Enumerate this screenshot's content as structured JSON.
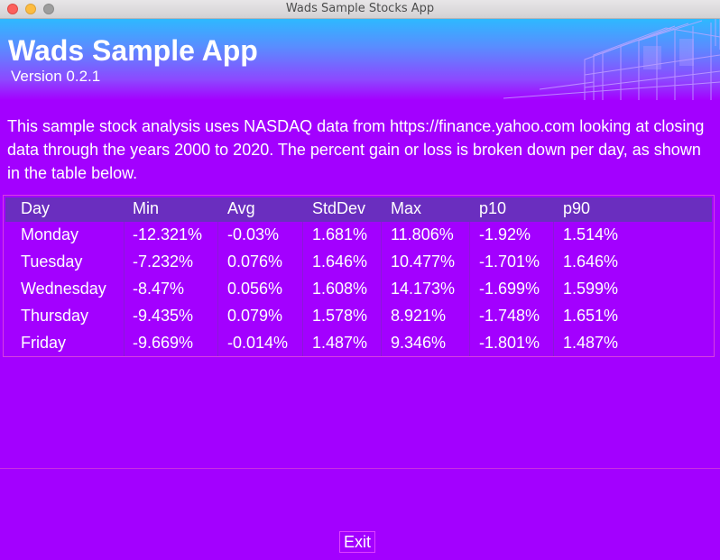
{
  "window": {
    "title": "Wads Sample Stocks App"
  },
  "header": {
    "title": "Wads Sample App",
    "version": "Version 0.2.1"
  },
  "description": "This sample stock analysis uses NASDAQ data from https://finance.yahoo.com looking at closing data through the years 2000 to 2020. The percent gain or loss is broken down per day, as shown in the table below.",
  "table": {
    "columns": [
      "Day",
      "Min",
      "Avg",
      "StdDev",
      "Max",
      "p10",
      "p90"
    ],
    "rows": [
      [
        "Monday",
        "-12.321%",
        "-0.03%",
        "1.681%",
        "11.806%",
        "-1.92%",
        "1.514%"
      ],
      [
        "Tuesday",
        "-7.232%",
        "0.076%",
        "1.646%",
        "10.477%",
        "-1.701%",
        "1.646%"
      ],
      [
        "Wednesday",
        "-8.47%",
        "0.056%",
        "1.608%",
        "14.173%",
        "-1.699%",
        "1.599%"
      ],
      [
        "Thursday",
        "-9.435%",
        "0.079%",
        "1.578%",
        "8.921%",
        "-1.748%",
        "1.651%"
      ],
      [
        "Friday",
        "-9.669%",
        "-0.014%",
        "1.487%",
        "9.346%",
        "-1.801%",
        "1.487%"
      ]
    ]
  },
  "footer": {
    "exit_label": "Exit"
  }
}
